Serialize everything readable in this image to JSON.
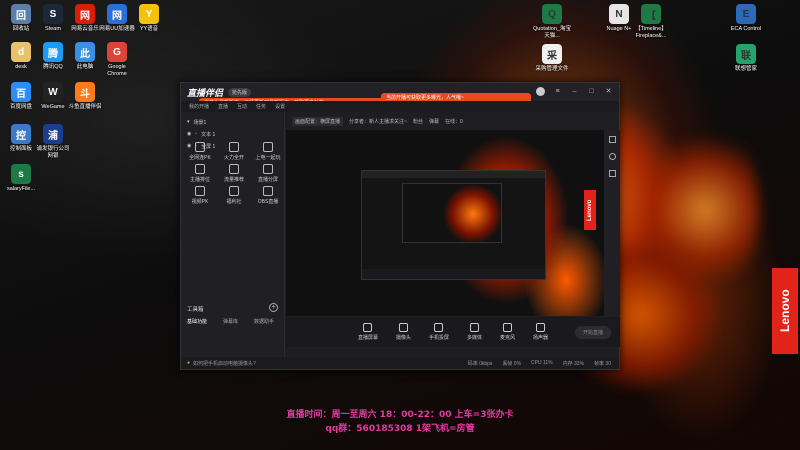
{
  "desktop_icons_left": [
    {
      "label": "回收站",
      "icon": "recycle-bin-icon",
      "color": "#5a7fa8"
    },
    {
      "label": "Steam",
      "icon": "steam-icon",
      "color": "#1b2838"
    },
    {
      "label": "网易云音乐",
      "icon": "netease-music-icon",
      "color": "#d81e06"
    },
    {
      "label": "网易UU加速器",
      "icon": "uu-booster-icon",
      "color": "#2b6fd6"
    },
    {
      "label": "YY语音",
      "icon": "yy-icon",
      "color": "#f4c20d"
    },
    {
      "label": "desk",
      "icon": "folder-icon",
      "color": "#e8c16a"
    },
    {
      "label": "腾讯QQ",
      "icon": "qq-icon",
      "color": "#1e9bf0"
    },
    {
      "label": "此电脑",
      "icon": "computer-icon",
      "color": "#3b8fe0"
    },
    {
      "label": "Google Chrome",
      "icon": "chrome-icon",
      "color": "#db4437"
    },
    {
      "label": "百度网盘",
      "icon": "baidu-netdisk-icon",
      "color": "#2f8cf5"
    },
    {
      "label": "WeGame",
      "icon": "wegame-icon",
      "color": "#222222"
    },
    {
      "label": "斗鱼直播伴侣",
      "icon": "douyu-icon",
      "color": "#ff7a1a"
    },
    {
      "label": "控制面板",
      "icon": "control-panel-icon",
      "color": "#3a7ac8"
    },
    {
      "label": "浦发银行公司网银",
      "icon": "bank-icon",
      "color": "#1c3e8c"
    },
    {
      "label": "salaryFile...",
      "icon": "excel-file-icon",
      "color": "#1d7a45"
    }
  ],
  "desktop_icons_right": [
    {
      "label": "Quotation_淘宝天猫...",
      "icon": "excel-file-icon",
      "color": "#1d7a45"
    },
    {
      "label": "Nuage N+",
      "icon": "document-icon",
      "color": "#e6e6e6"
    },
    {
      "label": "【Timeline】Fireplace&...",
      "icon": "excel-file-icon",
      "color": "#1d7a45"
    },
    {
      "label": "ECA Control",
      "icon": "eca-control-icon",
      "color": "#2a6ab8"
    },
    {
      "label": "采购管理文件",
      "icon": "document-icon",
      "color": "#f0f0f0"
    },
    {
      "label": "联想管家",
      "icon": "lenovo-manager-icon",
      "color": "#26a36a"
    }
  ],
  "window": {
    "logo": "直播伴侣",
    "version": "抢先版",
    "bubble1": "当前为最新版本，已经更新到最新版本，获取更多功能",
    "bubble2": "当前开播可获取更多曝光，人气哦~",
    "menu": [
      "我的开播",
      "直播",
      "互动",
      "任务",
      "设置"
    ],
    "subbar": [
      "画面配置：横屏直播",
      "分享者：新人主播求关注~",
      "粉丝",
      "弹幕",
      "在线：0"
    ],
    "scenes_title": "场景1",
    "scenes": [
      {
        "label": "文本 1"
      },
      {
        "label": "全屏 1"
      }
    ],
    "tools_title": "工具箱",
    "tool_tabs": [
      "基础功能",
      "弹幕库",
      "数据助手"
    ],
    "tools": [
      {
        "label": "全网连PK",
        "icon": "pk-icon"
      },
      {
        "label": "火力全开",
        "icon": "fire-icon"
      },
      {
        "label": "上电一起玩",
        "icon": "play-icon"
      },
      {
        "label": "主播排位",
        "icon": "rank-icon"
      },
      {
        "label": "流量推荐",
        "icon": "traffic-icon"
      },
      {
        "label": "直播分屏",
        "icon": "split-icon"
      },
      {
        "label": "视频PK",
        "icon": "video-pk-icon"
      },
      {
        "label": "福利社",
        "icon": "gift-icon"
      },
      {
        "label": "OBS直播",
        "icon": "obs-icon"
      }
    ],
    "bottom_buttons": [
      "直播屏幕",
      "摄像头",
      "手机投屏",
      "多媒体",
      "麦克风",
      "扬声器"
    ],
    "golive": "开始直播",
    "status_left": "如何把手机启动电脑摄像头?",
    "status_right": [
      "码率 0kbps",
      "丢帧 0%",
      "CPU 11%",
      "内存 33%",
      "帧率 30"
    ]
  },
  "captions": {
    "line1": "直播时间：周一至周六 18：00-22：00 上车=3张办卡",
    "line2": "qq群：560185308 1架飞机=房管"
  },
  "lenovo": "Lenovo"
}
